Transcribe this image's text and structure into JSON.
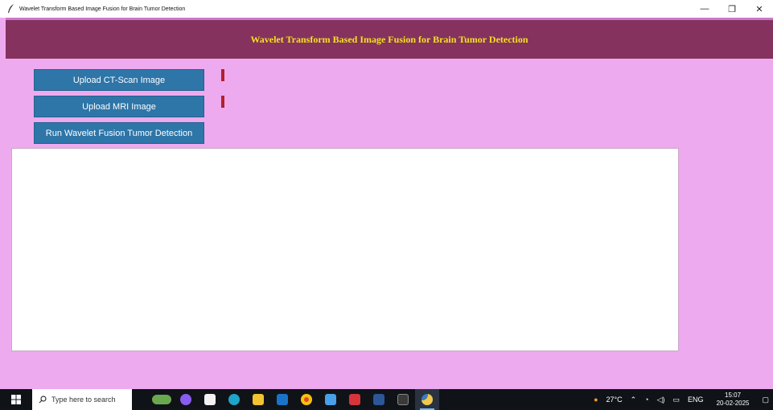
{
  "window": {
    "title": "Wavelet Transform Based Image Fusion for Brain Tumor Detection",
    "controls": {
      "minimize": "—",
      "restore": "❐",
      "close": "✕"
    }
  },
  "header": {
    "title": "Wavelet Transform Based Image Fusion for Brain Tumor Detection",
    "background": "#85325f",
    "title_color": "#f5e020"
  },
  "actions": {
    "upload_ct_label": "Upload CT-Scan Image",
    "upload_mri_label": "Upload MRI Image",
    "run_label": "Run Wavelet Fusion Tumor Detection"
  },
  "output": {
    "value": ""
  },
  "colors": {
    "app_background": "#eeaaee",
    "button": "#2e75a8",
    "marker": "#b3202c"
  },
  "taskbar": {
    "search_placeholder": "Type here to search",
    "pinned_icons": [
      "widgets-icon",
      "copilot-icon",
      "store-icon",
      "edge-icon",
      "file-explorer-icon",
      "outlook-icon",
      "chrome-icon",
      "files-icon",
      "app-icon",
      "word-icon",
      "terminal-icon",
      "python-icon"
    ],
    "weather": "27°C",
    "language": "ENG",
    "time": "15:07",
    "date": "20-02-2025"
  }
}
